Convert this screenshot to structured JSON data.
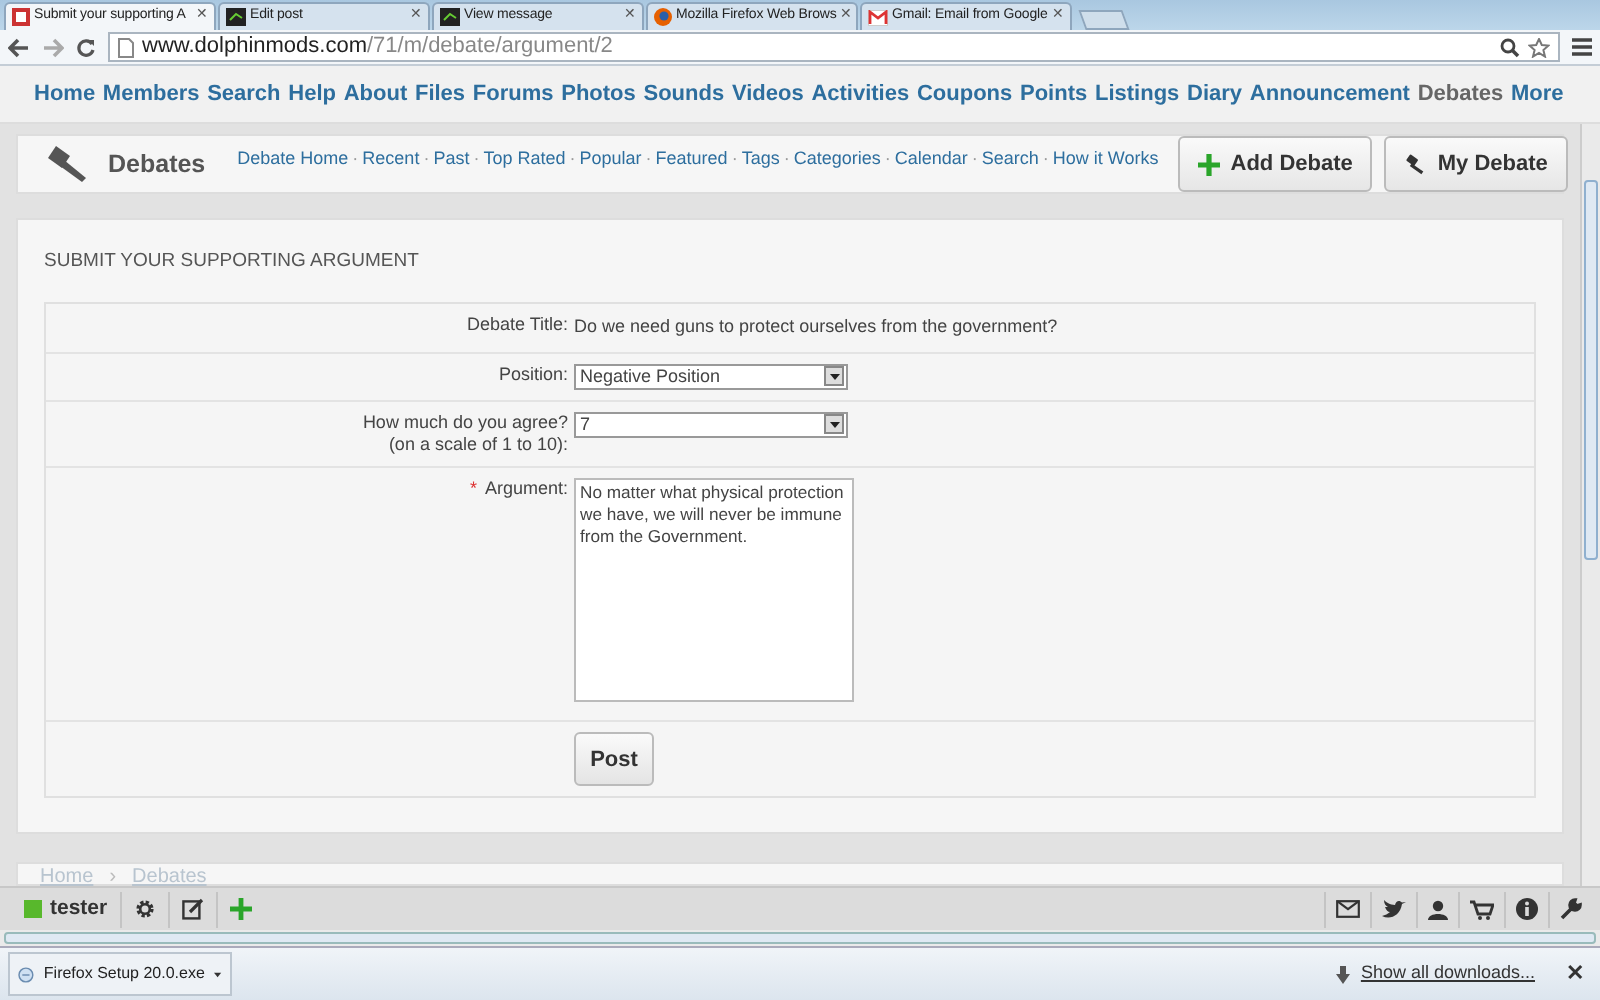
{
  "browser": {
    "tabs": [
      {
        "title": "Submit your supporting A",
        "selected": true,
        "close": "✕"
      },
      {
        "title": "Edit post",
        "selected": false,
        "close": "✕"
      },
      {
        "title": "View message",
        "selected": false,
        "close": "✕"
      },
      {
        "title": "Mozilla Firefox Web Brows",
        "selected": false,
        "close": "✕"
      },
      {
        "title": "Gmail: Email from Google",
        "selected": false,
        "close": "✕"
      }
    ],
    "url": {
      "host": "www.dolphinmods.com",
      "path": "/71/m/debate/argument/2"
    }
  },
  "nav": {
    "items": [
      {
        "label": "Home",
        "selected": false
      },
      {
        "label": "Members",
        "selected": false
      },
      {
        "label": "Search",
        "selected": false
      },
      {
        "label": "Help",
        "selected": false
      },
      {
        "label": "About",
        "selected": false
      },
      {
        "label": "Files",
        "selected": false
      },
      {
        "label": "Forums",
        "selected": false
      },
      {
        "label": "Photos",
        "selected": false
      },
      {
        "label": "Sounds",
        "selected": false
      },
      {
        "label": "Videos",
        "selected": false
      },
      {
        "label": "Activities",
        "selected": false
      },
      {
        "label": "Coupons",
        "selected": false
      },
      {
        "label": "Points",
        "selected": false
      },
      {
        "label": "Listings",
        "selected": false
      },
      {
        "label": "Diary",
        "selected": false
      },
      {
        "label": "Announcement",
        "selected": false
      },
      {
        "label": "Debates",
        "selected": true
      },
      {
        "label": "More",
        "selected": false
      }
    ]
  },
  "subnav": {
    "title": "Debates",
    "separator": "·",
    "links": [
      "Debate Home",
      "Recent",
      "Past",
      "Top Rated",
      "Popular",
      "Featured",
      "Tags",
      "Categories",
      "Calendar",
      "Search",
      "How it Works"
    ],
    "buttons": [
      {
        "label": "Add Debate",
        "kind": "add"
      },
      {
        "label": "My Debate",
        "kind": "gavel"
      }
    ]
  },
  "form": {
    "heading": "SUBMIT YOUR SUPPORTING ARGUMENT",
    "rows": [
      {
        "kind": "text",
        "label": "Debate Title:",
        "value": "Do we need guns to protect ourselves from the government?"
      },
      {
        "kind": "select",
        "label": "Position:",
        "value": "Negative Position"
      },
      {
        "kind": "select",
        "label": "How much do you agree?",
        "sublabel": "(on a scale of 1 to 10):",
        "value": "7"
      },
      {
        "kind": "textarea",
        "label": "Argument:",
        "value": "No matter what physical protection we have, we will never be immune from the Government.",
        "required_mark": "*"
      }
    ],
    "submit": "Post"
  },
  "breadcrumb": {
    "items": [
      "Home",
      "Debates"
    ],
    "separator": "›"
  },
  "toolbar": {
    "user": "tester"
  },
  "downloads": {
    "file": "Firefox Setup 20.0.exe",
    "show_all": "Show all downloads...",
    "close": "✕"
  }
}
